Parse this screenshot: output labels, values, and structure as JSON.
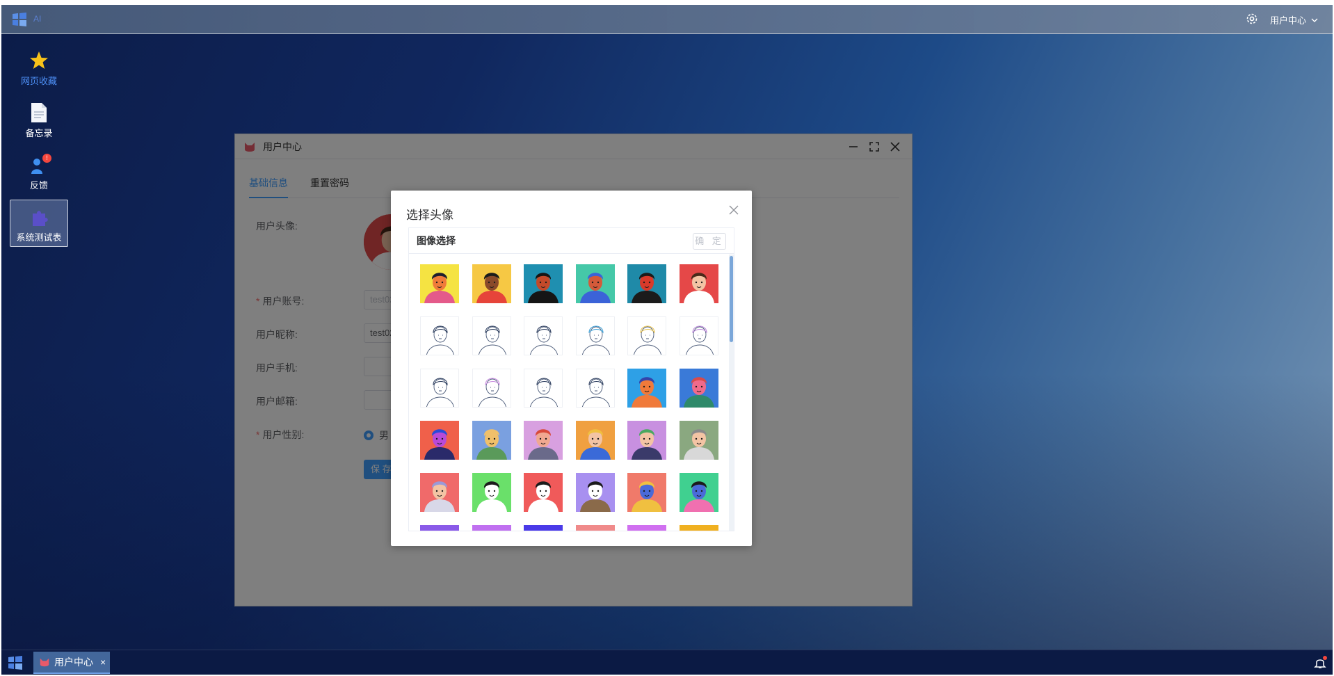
{
  "topbar": {
    "app_title": "AI",
    "user_menu_label": "用户中心"
  },
  "desktop_icons": [
    {
      "label": "网页收藏",
      "icon": "star-icon"
    },
    {
      "label": "备忘录",
      "icon": "document-icon"
    },
    {
      "label": "反馈",
      "icon": "user-feedback-icon",
      "badge": "!"
    },
    {
      "label": "系统测试表",
      "icon": "puzzle-icon"
    }
  ],
  "window": {
    "title": "用户中心",
    "tabs": [
      {
        "label": "基础信息",
        "active": true
      },
      {
        "label": "重置密码",
        "active": false
      }
    ],
    "form": {
      "avatar_label": "用户头像:",
      "account_label": "用户账号:",
      "account_value": "test02",
      "nickname_label": "用户昵称:",
      "nickname_value": "test02",
      "phone_label": "用户手机:",
      "email_label": "用户邮箱:",
      "gender_label": "用户性别:",
      "gender_value": "男",
      "save_label": "保 存"
    }
  },
  "dialog": {
    "title": "选择头像",
    "panel_title": "图像选择",
    "confirm_label": "确 定",
    "avatars": [
      {
        "bg": "#f5e342",
        "skin": "#f07b3a",
        "hair": "#1e1e2e",
        "shirt": "#e45a8a",
        "style": "color"
      },
      {
        "bg": "#f6c844",
        "skin": "#8a4a2a",
        "hair": "#1b1b1b",
        "shirt": "#e6443a",
        "style": "color"
      },
      {
        "bg": "#1f8fb0",
        "skin": "#c44a2a",
        "hair": "#151515",
        "shirt": "#151515",
        "style": "color"
      },
      {
        "bg": "#45c8a8",
        "skin": "#d45a3a",
        "hair": "#3b63d8",
        "shirt": "#3b63d8",
        "style": "color"
      },
      {
        "bg": "#1f8aa8",
        "skin": "#d83a2a",
        "hair": "#1b1b1b",
        "shirt": "#1b1b1b",
        "style": "color"
      },
      {
        "bg": "#e54848",
        "skin": "#f3c4a4",
        "hair": "#4a2a1a",
        "shirt": "#ffffff",
        "style": "color"
      },
      {
        "bg": "#ffffff",
        "skin": "#ffffff",
        "hair": "#2a3b5c",
        "shirt": "#ffffff",
        "style": "sketch"
      },
      {
        "bg": "#ffffff",
        "skin": "#ffffff",
        "hair": "#2a3b5c",
        "shirt": "#ffffff",
        "style": "sketch"
      },
      {
        "bg": "#ffffff",
        "skin": "#ffffff",
        "hair": "#2a3b5c",
        "shirt": "#ffffff",
        "style": "sketch"
      },
      {
        "bg": "#ffffff",
        "skin": "#ffffff",
        "hair": "#3aa0d8",
        "shirt": "#ffffff",
        "style": "sketch"
      },
      {
        "bg": "#ffffff",
        "skin": "#ffffff",
        "hair": "#e8c24a",
        "shirt": "#ffffff",
        "style": "sketch"
      },
      {
        "bg": "#ffffff",
        "skin": "#ffffff",
        "hair": "#b884d8",
        "shirt": "#ffffff",
        "style": "sketch"
      },
      {
        "bg": "#ffffff",
        "skin": "#ffffff",
        "hair": "#2a3b5c",
        "shirt": "#ffffff",
        "style": "sketch"
      },
      {
        "bg": "#ffffff",
        "skin": "#ffffff",
        "hair": "#c88ae0",
        "shirt": "#ffffff",
        "style": "sketch"
      },
      {
        "bg": "#ffffff",
        "skin": "#ffffff",
        "hair": "#2a3b5c",
        "shirt": "#ffffff",
        "style": "sketch"
      },
      {
        "bg": "#ffffff",
        "skin": "#ffffff",
        "hair": "#2a3b5c",
        "shirt": "#ffffff",
        "style": "sketch"
      },
      {
        "bg": "#2ea0e6",
        "skin": "#f07a3a",
        "hair": "#3344aa",
        "shirt": "#f07a3a",
        "style": "color"
      },
      {
        "bg": "#3a7ad8",
        "skin": "#f06a8a",
        "hair": "#d84a4a",
        "shirt": "#2f8a6a",
        "style": "color"
      },
      {
        "bg": "#f0604a",
        "skin": "#b84ad8",
        "hair": "#2a4ad8",
        "shirt": "#2a2a6a",
        "style": "color"
      },
      {
        "bg": "#7aa0e0",
        "skin": "#f0c06a",
        "hair": "#f0c06a",
        "shirt": "#5a9a5a",
        "style": "color"
      },
      {
        "bg": "#d8a0e0",
        "skin": "#f0a890",
        "hair": "#d84a3a",
        "shirt": "#6a6a8a",
        "style": "color"
      },
      {
        "bg": "#f0a040",
        "skin": "#f3c4a4",
        "hair": "#f0c040",
        "shirt": "#3a6ad8",
        "style": "color"
      },
      {
        "bg": "#c890e0",
        "skin": "#f3c4a4",
        "hair": "#4aa860",
        "shirt": "#3a3a6a",
        "style": "color"
      },
      {
        "bg": "#8aa880",
        "skin": "#f3c4a4",
        "hair": "#8a8a8a",
        "shirt": "#d8d8d8",
        "style": "color"
      },
      {
        "bg": "#f06a6a",
        "skin": "#f3c4a4",
        "hair": "#9a9ad8",
        "shirt": "#d8d8e8",
        "style": "color"
      },
      {
        "bg": "#6ae06a",
        "skin": "#ffffff",
        "hair": "#1b1b1b",
        "shirt": "#ffffff",
        "style": "color"
      },
      {
        "bg": "#f05a5a",
        "skin": "#ffffff",
        "hair": "#1b1b1b",
        "shirt": "#ffffff",
        "style": "color"
      },
      {
        "bg": "#a890f0",
        "skin": "#ffffff",
        "hair": "#1b1b1b",
        "shirt": "#8a6a4a",
        "style": "color"
      },
      {
        "bg": "#f07a6a",
        "skin": "#4a6ad8",
        "hair": "#f0c040",
        "shirt": "#f0c040",
        "style": "color"
      },
      {
        "bg": "#40d090",
        "skin": "#4a6ad8",
        "hair": "#1b1b1b",
        "shirt": "#f070b0",
        "style": "color"
      },
      {
        "bg": "#8a5ae8",
        "skin": "#8a5ae8",
        "hair": "#8a5ae8",
        "shirt": "#8a5ae8",
        "style": "color"
      },
      {
        "bg": "#c070f0",
        "skin": "#c070f0",
        "hair": "#c070f0",
        "shirt": "#c070f0",
        "style": "color"
      },
      {
        "bg": "#4a3ae8",
        "skin": "#4a3ae8",
        "hair": "#4a3ae8",
        "shirt": "#4a3ae8",
        "style": "color"
      },
      {
        "bg": "#f08a8a",
        "skin": "#f08a8a",
        "hair": "#1b1b1b",
        "shirt": "#f08a8a",
        "style": "color"
      },
      {
        "bg": "#d070f0",
        "skin": "#d070f0",
        "hair": "#d070f0",
        "shirt": "#d070f0",
        "style": "color"
      },
      {
        "bg": "#f0b020",
        "skin": "#f0b020",
        "hair": "#1b1b1b",
        "shirt": "#f0b020",
        "style": "color"
      }
    ]
  },
  "taskbar": {
    "task_label": "用户中心"
  },
  "colors": {
    "accent": "#409eff",
    "required": "#f56c6c",
    "mask": "rgba(0,0,0,0.5)"
  }
}
